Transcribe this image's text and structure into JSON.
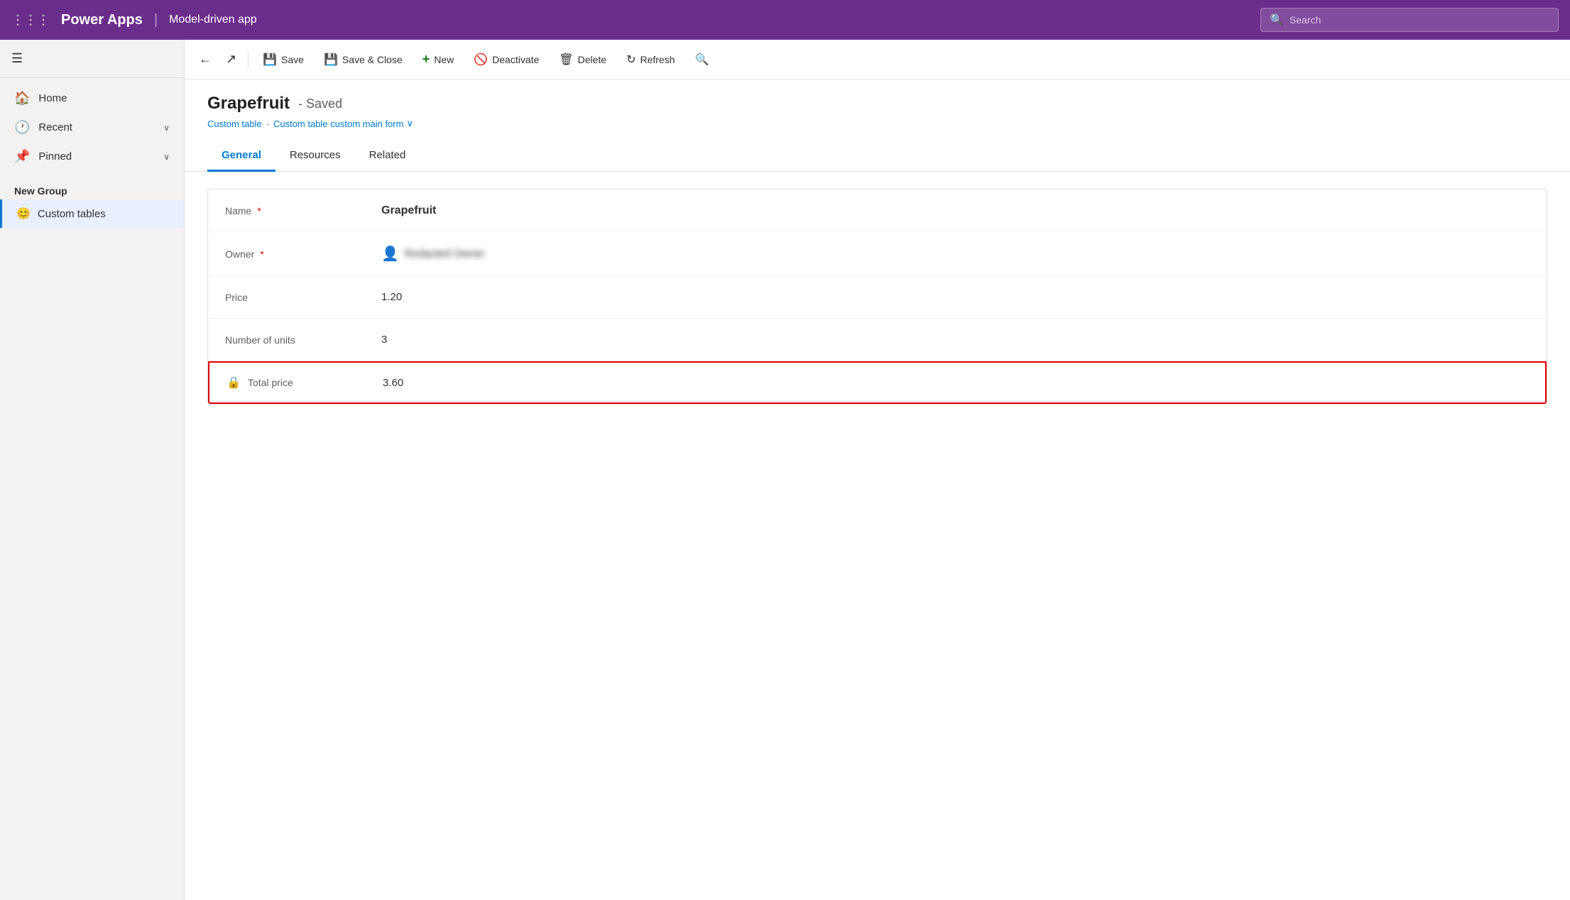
{
  "header": {
    "app_name": "Power Apps",
    "app_type": "Model-driven app",
    "search_placeholder": "Search",
    "grid_icon": "⋮⋮⋮"
  },
  "toolbar": {
    "back_label": "←",
    "external_icon": "↗",
    "save_label": "Save",
    "save_close_label": "Save & Close",
    "new_label": "New",
    "deactivate_label": "Deactivate",
    "delete_label": "Delete",
    "refresh_label": "Refresh",
    "search_icon": "🔍"
  },
  "sidebar": {
    "hamburger": "☰",
    "nav_items": [
      {
        "icon": "🏠",
        "label": "Home"
      },
      {
        "icon": "🕐",
        "label": "Recent",
        "has_chevron": true
      },
      {
        "icon": "📌",
        "label": "Pinned",
        "has_chevron": true
      }
    ],
    "group_label": "New Group",
    "table_item": {
      "emoji": "😊",
      "label": "Custom tables"
    }
  },
  "form": {
    "title": "Grapefruit",
    "status": "- Saved",
    "breadcrumb_table": "Custom table",
    "breadcrumb_form": "Custom table custom main form",
    "chevron_down": "∨",
    "tabs": [
      {
        "label": "General",
        "active": true
      },
      {
        "label": "Resources",
        "active": false
      },
      {
        "label": "Related",
        "active": false
      }
    ],
    "fields": [
      {
        "label": "Name",
        "required": true,
        "value": "Grapefruit",
        "type": "text",
        "bold": true
      },
      {
        "label": "Owner",
        "required": true,
        "value": "Redacted Owner",
        "type": "owner"
      },
      {
        "label": "Price",
        "required": false,
        "value": "1.20",
        "type": "text"
      },
      {
        "label": "Number of units",
        "required": false,
        "value": "3",
        "type": "text"
      },
      {
        "label": "Total price",
        "required": false,
        "value": "3.60",
        "type": "locked",
        "highlighted": true
      }
    ]
  }
}
